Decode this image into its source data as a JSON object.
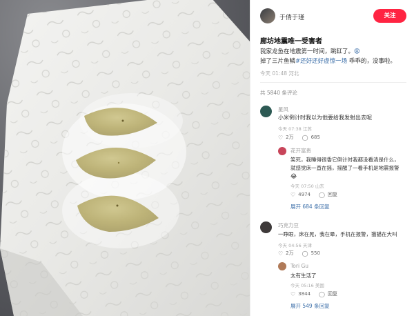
{
  "header": {
    "username": "于倩于瑾",
    "follow_label": "关注"
  },
  "post": {
    "title": "廊坊地震唯一受害者",
    "body_line1": "我家龙鱼在地震第一时间，跳缸了。",
    "body_emoji": "😩",
    "body_line2_prefix": "掉了三片鱼鳞",
    "body_tag": "#还好还好虚惊一场",
    "body_line2_suffix": " 乖乖的，没事啦。",
    "meta": "今天 01:48 河北"
  },
  "comments_header": "共 5840 条评论",
  "comments": [
    {
      "name": "星风",
      "text": "小米倒计时我以为他要给我发射出去呢",
      "time": "今天 07:38 江苏",
      "likes": "2万",
      "replies": "685",
      "avatar_color": "#2d5a54"
    },
    {
      "name": "花开富贵",
      "text_line1": "笑死，我睡得很香它倒计时我都没看清是什么，",
      "text_line2": "就感觉床一直在摇，摇醒了一看手机是地震报警",
      "emoji": "😂",
      "time": "今天 07:50 山东",
      "likes": "4974",
      "replies": "回复",
      "expand": "展开 684 条回复",
      "avatar_color": "#c8455a"
    },
    {
      "name": "巧克力豆",
      "text": "一睁眼，床在晃，我在晕，手机在报警，猫猫在大叫",
      "time": "今天 04:56 天津",
      "likes": "2万",
      "replies": "550",
      "avatar_color": "#3e3a3a"
    },
    {
      "name": "Tori Gu",
      "text": "太有生活了",
      "time": "今天 05:16 美国",
      "likes": "3844",
      "replies": "回复",
      "expand": "展开 549 条回复",
      "avatar_color": "#b07a58"
    }
  ],
  "icons": {
    "like": "heart-icon",
    "reply": "chat-bubble-icon"
  }
}
